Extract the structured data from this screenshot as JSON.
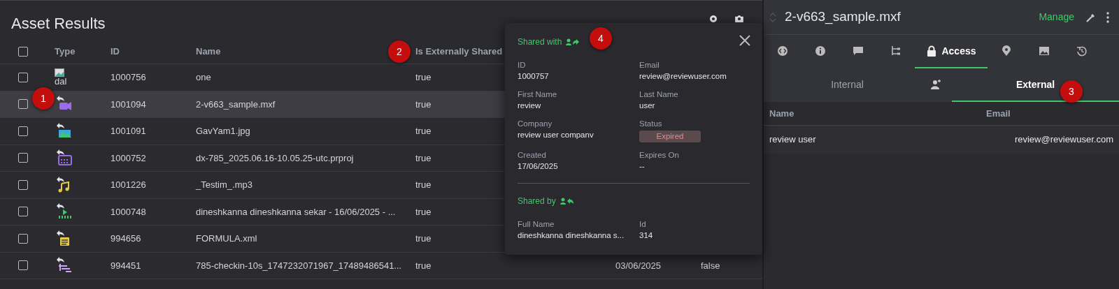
{
  "results": {
    "title": "Asset Results",
    "all_checked": false,
    "columns": [
      "Type",
      "ID",
      "Name",
      "Is Externally Shared"
    ],
    "rows": [
      {
        "kind": "broken",
        "type_alt": "dal",
        "id": "1000756",
        "name": "one",
        "shared": "true",
        "selected": false,
        "checked": false
      },
      {
        "kind": "video",
        "id": "1001094",
        "name": "2-v663_sample.mxf",
        "shared": "true",
        "selected": true,
        "checked": false
      },
      {
        "kind": "image",
        "id": "1001091",
        "name": "GavYam1.jpg",
        "shared": "true",
        "selected": false,
        "checked": false
      },
      {
        "kind": "project",
        "id": "1000752",
        "name": "dx-785_2025.06.16-10.05.25-utc.prproj",
        "shared": "true",
        "selected": false,
        "checked": false
      },
      {
        "kind": "audio",
        "id": "1001226",
        "name": "_Testim_.mp3",
        "shared": "true",
        "selected": false,
        "checked": false
      },
      {
        "kind": "sequence",
        "id": "1000748",
        "name": "dineshkanna dineshkanna sekar - 16/06/2025 - ...",
        "shared": "true",
        "selected": false,
        "checked": false
      },
      {
        "kind": "document",
        "id": "994656",
        "name": "FORMULA.xml",
        "shared": "true",
        "selected": false,
        "checked": false
      },
      {
        "kind": "subclip",
        "id": "994451",
        "name": "785-checkin-10s_1747232071967_17489486541...",
        "shared": "true",
        "column_5": "03/06/2025",
        "column_6": "false",
        "selected": false,
        "checked": false
      }
    ]
  },
  "popup": {
    "shared_with": {
      "title": "Shared with",
      "fields": [
        {
          "label": "ID",
          "value": "1000757"
        },
        {
          "label": "Email",
          "value": "review@reviewuser.com"
        },
        {
          "label": "First Name",
          "value": "review"
        },
        {
          "label": "Last Name",
          "value": "user"
        },
        {
          "label": "Company",
          "value": "review user companv"
        },
        {
          "label": "Status",
          "value": "Expired",
          "kind": "badge"
        },
        {
          "label": "Created",
          "value": "17/06/2025"
        },
        {
          "label": "Expires On",
          "value": "--"
        }
      ]
    },
    "shared_by": {
      "title": "Shared by",
      "fields": [
        {
          "label": "Full Name",
          "value": "dineshkanna dineshkanna s..."
        },
        {
          "label": "Id",
          "value": "314"
        }
      ]
    }
  },
  "detail": {
    "title": "2-v663_sample.mxf",
    "manage": "Manage",
    "tabs": [
      {
        "kind": "code",
        "selected": false
      },
      {
        "kind": "info",
        "selected": false
      },
      {
        "kind": "comment",
        "selected": false
      },
      {
        "kind": "hierarchy",
        "selected": false
      },
      {
        "kind": "lock",
        "label": "Access",
        "selected": true
      },
      {
        "kind": "pin",
        "selected": false
      },
      {
        "kind": "image",
        "selected": false
      },
      {
        "kind": "history",
        "selected": false
      }
    ],
    "subtabs": [
      {
        "label": "Internal",
        "selected": false
      },
      {
        "label": "External",
        "selected": true
      }
    ],
    "columns": [
      "Name",
      "Email"
    ],
    "rows": [
      {
        "name": "review user",
        "email": "review@reviewuser.com"
      }
    ]
  },
  "annotations": [
    {
      "number": "1"
    },
    {
      "number": "2"
    },
    {
      "number": "3"
    },
    {
      "number": "4"
    }
  ]
}
